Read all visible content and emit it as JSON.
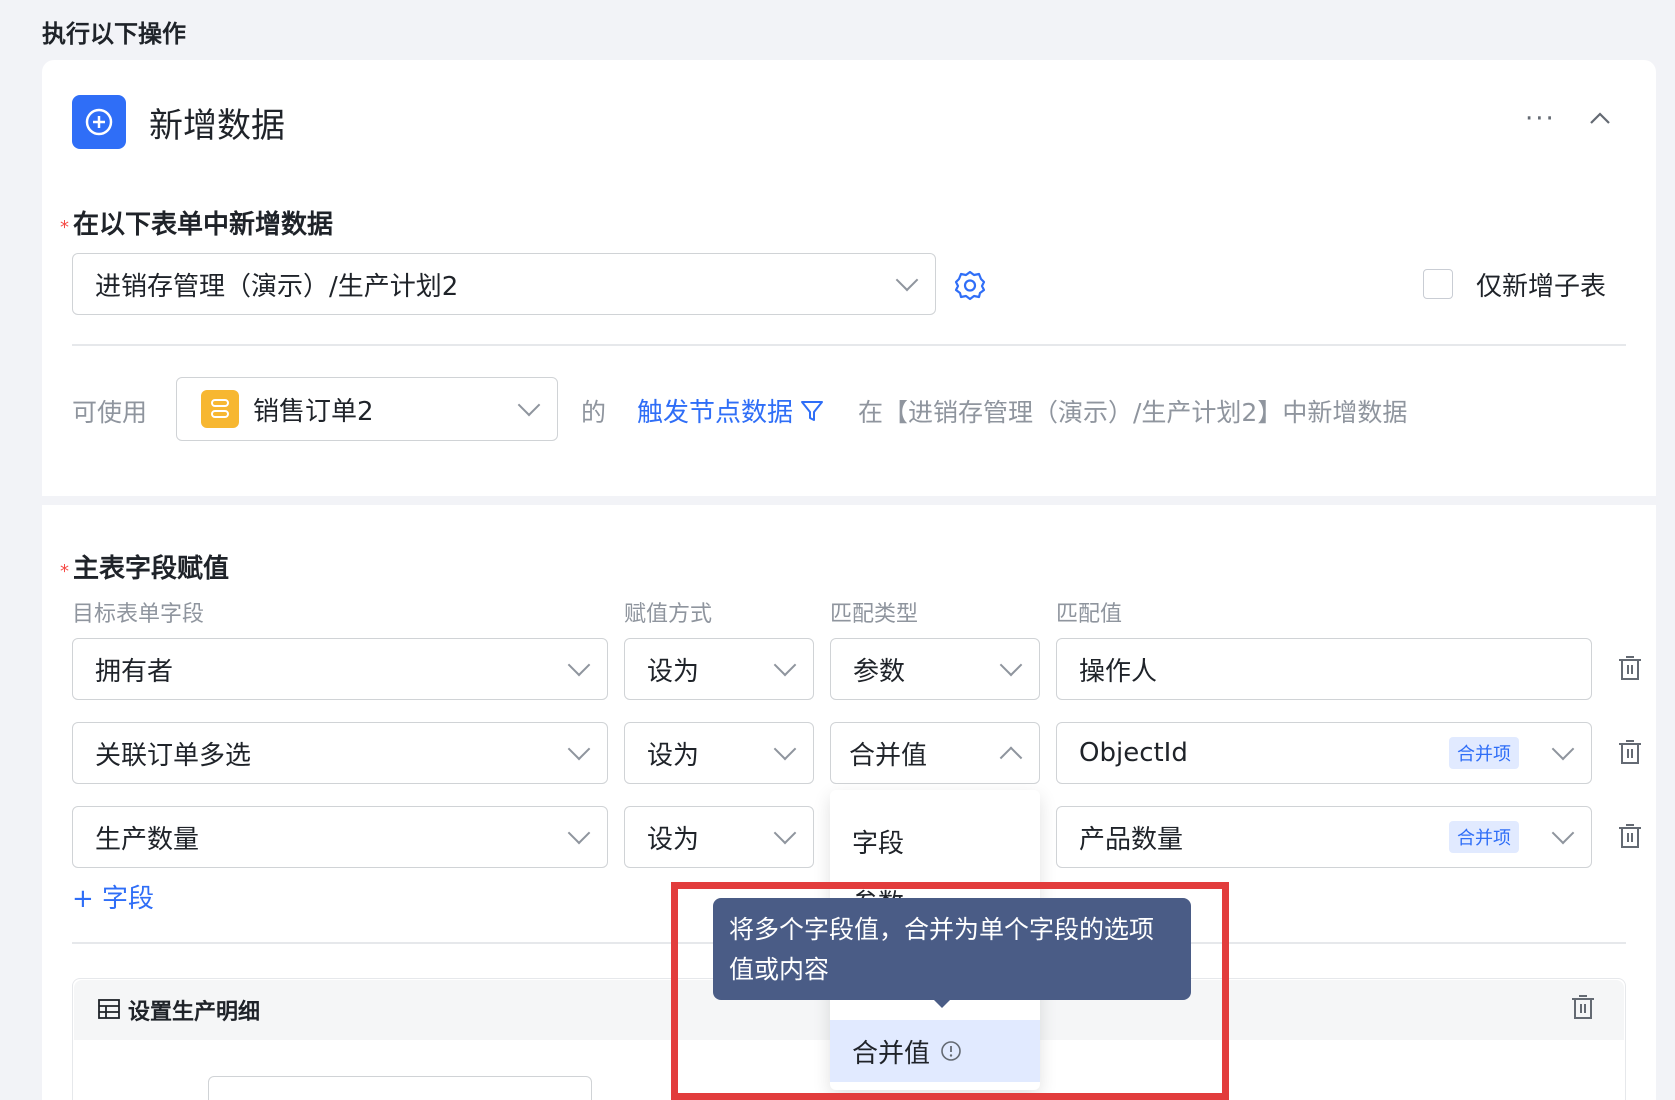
{
  "section_title": "执行以下操作",
  "card": {
    "title": "新增数据",
    "more_label": "···"
  },
  "target": {
    "label": "在以下表单中新增数据",
    "form_value": "进销存管理（演示）/生产计划2",
    "checkbox_label": "仅新增子表"
  },
  "usable": {
    "label": "可使用",
    "source_value": "销售订单2",
    "of_text": "的",
    "trigger_link": "触发节点数据",
    "description": "在【进销存管理（演示）/生产计划2】中新增数据"
  },
  "main_fields": {
    "label": "主表字段赋值",
    "headers": [
      "目标表单字段",
      "赋值方式",
      "匹配类型",
      "匹配值"
    ],
    "rows": [
      {
        "field": "拥有者",
        "method": "设为",
        "match_type": "参数",
        "value": "操作人",
        "tag": ""
      },
      {
        "field": "关联订单多选",
        "method": "设为",
        "match_type": "合并值",
        "value": "ObjectId",
        "tag": "合并项"
      },
      {
        "field": "生产数量",
        "method": "设为",
        "match_type": "",
        "value": "产品数量",
        "tag": "合并项"
      }
    ],
    "add_field": "+ 字段"
  },
  "dropdown": {
    "options": [
      "字段",
      "参数",
      "合并值"
    ],
    "selected": "合并值"
  },
  "tooltip": {
    "text": "将多个字段值，合并为单个字段的选项值或内容"
  },
  "sub_table": {
    "title": "设置生产明细"
  },
  "colors": {
    "accent": "#2f6ef7",
    "required": "#f54a45",
    "highlight": "#e23c3c",
    "tooltip_bg": "#4a5c86",
    "source_icon": "#f7b731"
  }
}
